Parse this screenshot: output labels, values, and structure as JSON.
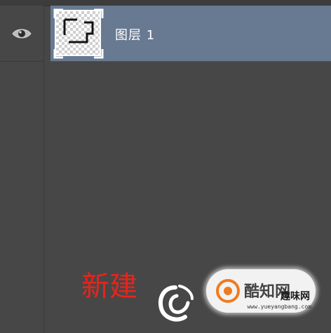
{
  "layers": [
    {
      "name": "图层 1",
      "visible": true,
      "selected": true
    }
  ],
  "overlay": {
    "caption": "新建",
    "watermark": {
      "brand": "酷知网",
      "tag": "趣味网",
      "url": "www.yueyangbang.com"
    }
  },
  "colors": {
    "panel_bg": "#474747",
    "selected_row": "#687a92",
    "caption": "#e8241c",
    "logo_orange": "#f07a1f"
  },
  "icons": [
    "eye-icon",
    "layer-thumbnail",
    "brand-logo-icon"
  ]
}
